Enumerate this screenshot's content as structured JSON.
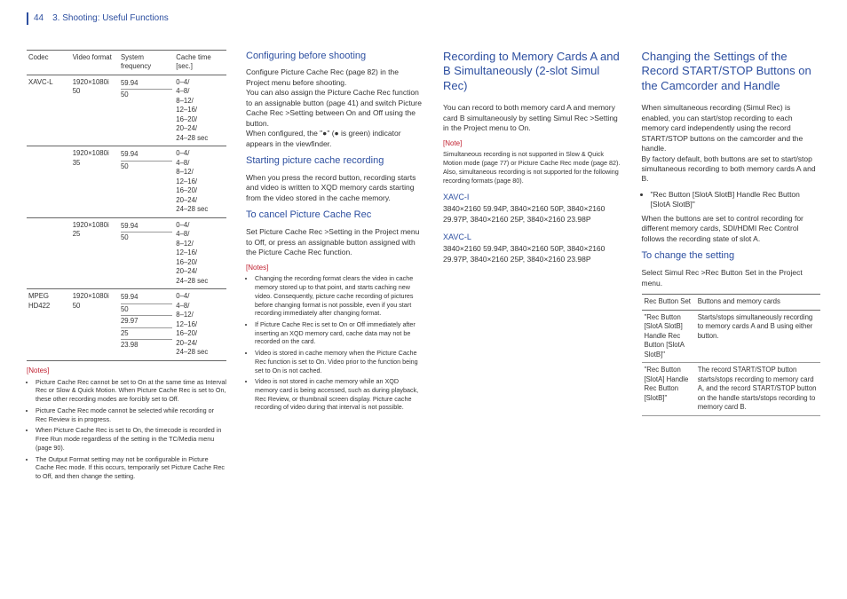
{
  "header": {
    "page": "44",
    "breadcrumb": "3. Shooting: Useful Functions"
  },
  "codec_table": {
    "headers": [
      "Codec",
      "Video format",
      "System frequency",
      "Cache time [sec.]"
    ],
    "rows": [
      {
        "codec": "XAVC-L",
        "vf": "1920×1080i 50",
        "freq": [
          "59.94",
          "50"
        ],
        "cache": "0–4/\n4–8/\n8–12/\n12–16/\n16–20/\n20–24/\n24–28 sec"
      },
      {
        "codec": "",
        "vf": "1920×1080i 35",
        "freq": [
          "59.94",
          "50"
        ],
        "cache": "0–4/\n4–8/\n8–12/\n12–16/\n16–20/\n20–24/\n24–28 sec"
      },
      {
        "codec": "",
        "vf": "1920×1080i 25",
        "freq": [
          "59.94",
          "50"
        ],
        "cache": "0–4/\n4–8/\n8–12/\n12–16/\n16–20/\n20–24/\n24–28 sec"
      },
      {
        "codec": "MPEG HD422",
        "vf": "1920×1080i 50",
        "freq": [
          "59.94",
          "50",
          "29.97",
          "25",
          "23.98"
        ],
        "cache": "0–4/\n4–8/\n8–12/\n12–16/\n16–20/\n20–24/\n24–28 sec"
      }
    ]
  },
  "col1_notes": {
    "label": "[Notes]",
    "items": [
      "Picture Cache Rec cannot be set to On at the same time as Interval Rec or Slow & Quick Motion. When Picture Cache Rec is set to On, these other recording modes are forcibly set to Off.",
      "Picture Cache Rec mode cannot be selected while recording or Rec Review is in progress.",
      "When Picture Cache Rec is set to On, the timecode is recorded in Free Run mode regardless of the setting in the TC/Media menu (page 90).",
      "The Output Format setting may not be configurable in Picture Cache Rec mode. If this occurs, temporarily set Picture Cache Rec to Off, and then change the setting."
    ]
  },
  "col2": {
    "h1": "Configuring before shooting",
    "p1": "Configure Picture Cache Rec (page 82) in the Project menu before shooting.\nYou can also assign the Picture Cache Rec function to an assignable button (page 41) and switch Picture Cache Rec >Setting between On and Off using the button.\nWhen configured, the \"●\" (● is green) indicator appears in the viewfinder.",
    "h2": "Starting picture cache recording",
    "p2": "When you press the record button, recording starts and video is written to XQD memory cards starting from the video stored in the cache memory.",
    "h3": "To cancel Picture Cache Rec",
    "p3": "Set Picture Cache Rec >Setting in the Project menu to Off, or press an assignable button assigned with the Picture Cache Rec function.",
    "notes_label": "[Notes]",
    "notes": [
      "Changing the recording format clears the video in cache memory stored up to that point, and starts caching new video. Consequently, picture cache recording of pictures before changing format is not possible, even if you start recording immediately after changing format.",
      "If Picture Cache Rec is set to On or Off immediately after inserting an XQD memory card, cache data may not be recorded on the card.",
      "Video is stored in cache memory when the Picture Cache Rec function is set to On. Video prior to the function being set to On is not cached.",
      "Video is not stored in cache memory while an XQD memory card is being accessed, such as during playback, Rec Review, or thumbnail screen display. Picture cache recording of video during that interval is not possible."
    ]
  },
  "col3": {
    "title": "Recording to Memory Cards A and B Simultaneously (2-slot Simul Rec)",
    "p1": "You can record to both memory card A and memory card B simultaneously by setting Simul Rec >Setting in the Project menu to On.",
    "note_label": "[Note]",
    "note": "Simultaneous recording is not supported in Slow & Quick Motion mode (page 77) or Picture Cache Rec mode (page 82). Also, simultaneous recording is not supported for the following recording formats (page 80).",
    "xavci_h": "XAVC-I",
    "xavci": "3840×2160 59.94P, 3840×2160 50P, 3840×2160 29.97P, 3840×2160 25P, 3840×2160 23.98P",
    "xavcl_h": "XAVC-L",
    "xavcl": "3840×2160 59.94P, 3840×2160 50P, 3840×2160 29.97P, 3840×2160 25P, 3840×2160 23.98P"
  },
  "col4": {
    "title": "Changing the Settings of the Record START/STOP Buttons on the Camcorder and Handle",
    "p1": "When simultaneous recording (Simul Rec) is enabled, you can start/stop recording to each memory card independently using the record START/STOP buttons on the camcorder and the handle.\nBy factory default, both buttons are set to start/stop simultaneous recording to both memory cards A and B.",
    "bullet": "\"Rec Button [SlotA SlotB] Handle Rec Button [SlotA SlotB]\"",
    "p2": "When the buttons are set to control recording for different memory cards, SDI/HDMI Rec Control follows the recording state of slot A.",
    "sub": "To change the setting",
    "p3": "Select Simul Rec >Rec Button Set in the Project menu.",
    "rec_table": {
      "headers": [
        "Rec Button Set",
        "Buttons and memory cards"
      ],
      "rows": [
        {
          "a": "\"Rec Button [SlotA SlotB] Handle Rec Button [SlotA SlotB]\"",
          "b": "Starts/stops simultaneously recording to memory cards A and B using either button."
        },
        {
          "a": "\"Rec Button [SlotA] Handle Rec Button [SlotB]\"",
          "b": "The record START/STOP button starts/stops recording to memory card A, and the record START/STOP button on the handle starts/stops recording to memory card B."
        }
      ]
    }
  }
}
